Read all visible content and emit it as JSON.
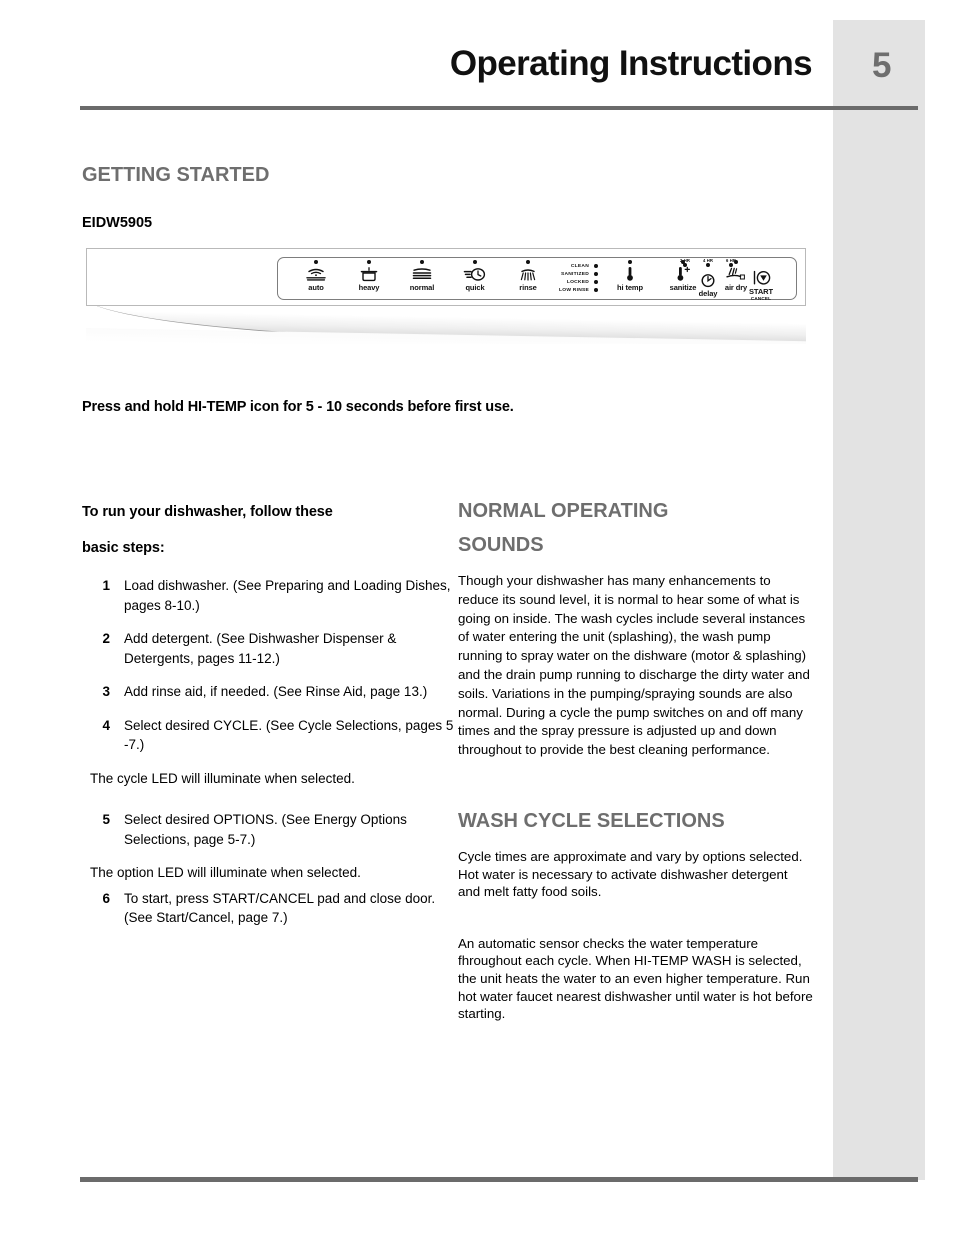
{
  "header": {
    "title": "Operating Instructions",
    "page_number": "5"
  },
  "sections": {
    "getting_started": "GETTING STARTED",
    "model": "EIDW5905",
    "notice": "Press and hold HI-TEMP icon for 5 - 10 seconds before first use.",
    "normal_sounds": "NORMAL OPERATING",
    "normal_sounds_2": "SOUNDS",
    "wash_cycle": "WASH CYCLE SELECTIONS"
  },
  "control_panel": {
    "cycle_pads": [
      {
        "label": "auto",
        "icon": "auto-wash-icon"
      },
      {
        "label": "heavy",
        "icon": "heavy-pot-icon"
      },
      {
        "label": "normal",
        "icon": "normal-plates-icon"
      },
      {
        "label": "quick",
        "icon": "quick-clock-icon"
      },
      {
        "label": "rinse",
        "icon": "rinse-spray-icon"
      }
    ],
    "status_leds": [
      "CLEAN",
      "SANITIZED",
      "LOCKED",
      "LOW RINSE"
    ],
    "option_pads": [
      {
        "label": "hi temp",
        "icon": "thermometer-icon"
      },
      {
        "label": "sanitize",
        "icon": "thermometer-plus-icon"
      },
      {
        "label": "air dry",
        "icon": "air-dry-icon"
      },
      {
        "label": "delay",
        "icon": "delay-clock-icon"
      }
    ],
    "delay_hours": [
      "2 HR",
      "4 HR",
      "6 HR"
    ],
    "start_pad": {
      "label": "START",
      "sub": "CANCEL",
      "icon": "start-cancel-icon"
    }
  },
  "left_column": {
    "lead_line1": "To run your dishwasher, follow these",
    "lead_line2": "basic steps:",
    "steps": [
      {
        "num": "1",
        "text": "Load dishwasher. (See Preparing and Loading Dishes, pages 8-10.)"
      },
      {
        "num": "2",
        "text": "Add detergent. (See Dishwasher Dispenser & Detergents, pages 11-12.)"
      },
      {
        "num": "3",
        "text": "Add rinse aid, if needed. (See Rinse Aid, page 13.)"
      },
      {
        "num": "4",
        "text": "Select desired CYCLE. (See Cycle Selections, pages 5 -7.)"
      },
      {
        "num": "5",
        "text": "Select desired OPTIONS. (See Energy Options Selections, page 5-7.)"
      },
      {
        "num": "6",
        "text": "To start, press START/CANCEL pad and close door. (See Start/Cancel, page 7.)"
      }
    ],
    "cycle_led_note": "The cycle LED will illuminate when selected.",
    "option_led_note": "The option LED will illuminate when selected."
  },
  "right_column": {
    "sounds_para": "Though your dishwasher has many enhancements to reduce its sound level, it is normal to hear some of what is going on inside.  The wash cycles include several instances of water entering the unit (splashing), the wash pump running to spray water on the dishware (motor & splashing) and the drain pump running to discharge the dirty water and soils.  Variations in the pumping/spraying sounds are also normal.  During a cycle the pump switches on and off many times and the spray pressure is adjusted up and down throughout to provide the best cleaning performance.",
    "wash_para_1": "Cycle times are approximate and vary by options selected. Hot water is necessary to activate dishwasher detergent and melt fatty food soils.",
    "wash_para_2": "An automatic sensor checks the water temperature fhroughout each cycle. When HI-TEMP WASH is selected, the unit heats the water to an even higher temperature.  Run hot water faucet nearest dishwasher until water is hot before starting."
  },
  "colors": {
    "heading_gray": "#6e6e6e",
    "rule_gray": "#6b6b6b",
    "side_tab_gray": "#e3e3e3"
  }
}
